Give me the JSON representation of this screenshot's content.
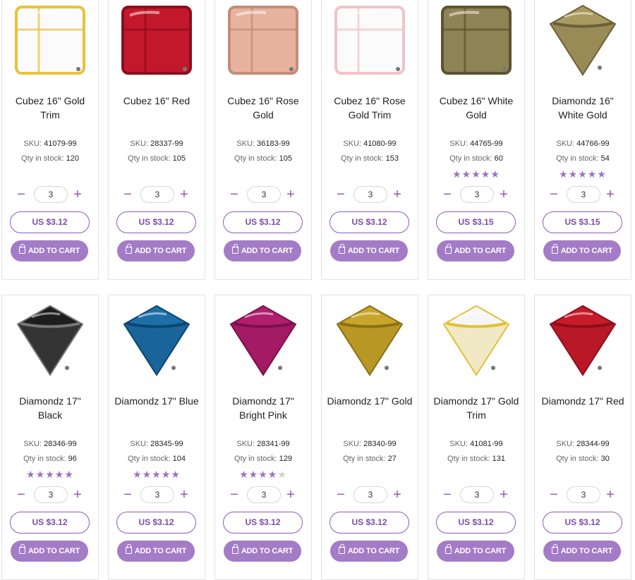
{
  "labels": {
    "sku": "SKU:",
    "qty": "Qty in stock:",
    "add_to_cart": "ADD TO CART",
    "minus": "−",
    "plus": "+"
  },
  "products": [
    {
      "title": "Cubez 16\" Gold Trim",
      "sku": "41079-99",
      "stock": "120",
      "qty": "3",
      "price": "US $3.12",
      "rating": null,
      "shape": "cube",
      "color": "#fbfbfb",
      "edge": "#e8c33a"
    },
    {
      "title": "Cubez 16\" Red",
      "sku": "28337-99",
      "stock": "105",
      "qty": "3",
      "price": "US $3.12",
      "rating": null,
      "shape": "cube",
      "color": "#c3182c",
      "edge": "#8f0d1c"
    },
    {
      "title": "Cubez 16\" Rose Gold",
      "sku": "36183-99",
      "stock": "105",
      "qty": "3",
      "price": "US $3.12",
      "rating": null,
      "shape": "cube",
      "color": "#e7b29e",
      "edge": "#c48d78"
    },
    {
      "title": "Cubez 16\" Rose Gold Trim",
      "sku": "41080-99",
      "stock": "153",
      "qty": "3",
      "price": "US $3.12",
      "rating": null,
      "shape": "cube",
      "color": "#fbfbfb",
      "edge": "#f0c3c8"
    },
    {
      "title": "Cubez 16\" White Gold",
      "sku": "44765-99",
      "stock": "60",
      "qty": "3",
      "price": "US $3.15",
      "rating": 5,
      "shape": "cube",
      "color": "#8e8354",
      "edge": "#5c542f"
    },
    {
      "title": "Diamondz 16\" White Gold",
      "sku": "44766-99",
      "stock": "54",
      "qty": "3",
      "price": "US $3.15",
      "rating": 5,
      "shape": "diamond",
      "color": "#a99a5f",
      "edge": "#6b6038"
    },
    {
      "title": "Diamondz 17\" Black",
      "sku": "28346-99",
      "stock": "96",
      "qty": "3",
      "price": "US $3.12",
      "rating": 5,
      "shape": "diamond",
      "color": "#1e1e1e",
      "edge": "#777777"
    },
    {
      "title": "Diamondz 17\" Blue",
      "sku": "28345-99",
      "stock": "104",
      "qty": "3",
      "price": "US $3.12",
      "rating": 5,
      "shape": "diamond",
      "color": "#1d6fa8",
      "edge": "#0e4570"
    },
    {
      "title": "Diamondz 17\" Bright Pink",
      "sku": "28341-99",
      "stock": "129",
      "qty": "3",
      "price": "US $3.12",
      "rating": 4,
      "shape": "diamond",
      "color": "#b01e6e",
      "edge": "#7c0f4b"
    },
    {
      "title": "Diamondz 17\" Gold",
      "sku": "28340-99",
      "stock": "27",
      "qty": "3",
      "price": "US $3.12",
      "rating": null,
      "shape": "diamond",
      "color": "#c9a52b",
      "edge": "#8a7014"
    },
    {
      "title": "Diamondz 17\" Gold Trim",
      "sku": "41081-99",
      "stock": "131",
      "qty": "3",
      "price": "US $3.12",
      "rating": null,
      "shape": "diamond",
      "color": "#f6f6f6",
      "edge": "#e3c033"
    },
    {
      "title": "Diamondz 17\" Red",
      "sku": "28344-99",
      "stock": "30",
      "qty": "3",
      "price": "US $3.12",
      "rating": null,
      "shape": "diamond",
      "color": "#c81b2a",
      "edge": "#8c0f1a"
    }
  ]
}
